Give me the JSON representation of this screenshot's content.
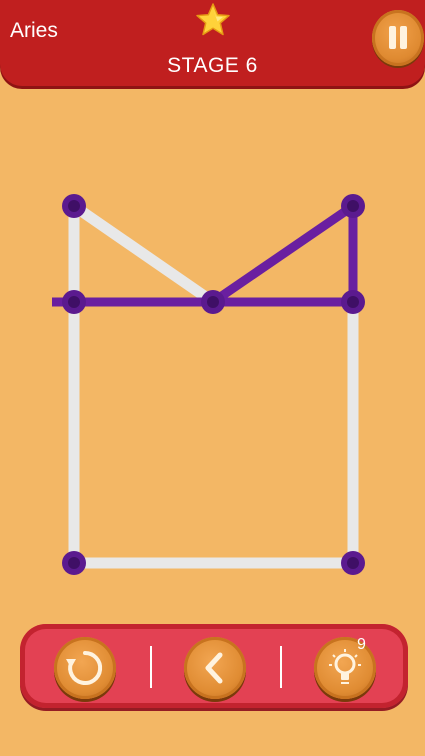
{
  "header": {
    "level_name": "Aries",
    "stage_label": "STAGE 6",
    "star_icon": "star-icon",
    "pause_icon": "pause-icon"
  },
  "puzzle": {
    "total_segments": 8,
    "drawn_segments": 4,
    "colors": {
      "background": "#f3b765",
      "undrawn_line": "#e8e8e8",
      "drawn_line": "#6a1fa0",
      "node": "#5b1a8f"
    }
  },
  "toolbar": {
    "restart_icon": "restart-icon",
    "back_icon": "back-icon",
    "hint_icon": "lightbulb-icon",
    "hint_count": "9"
  }
}
